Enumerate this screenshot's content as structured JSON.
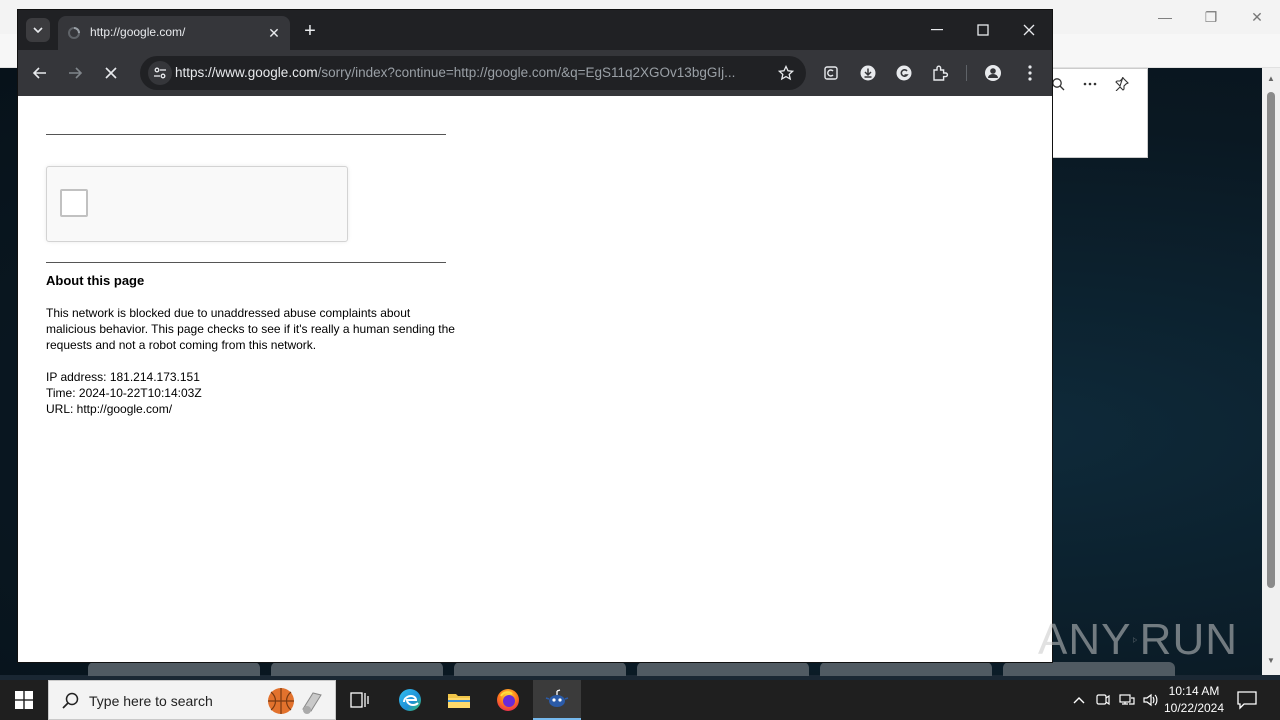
{
  "browser": {
    "tab_title": "http://google.com/",
    "url_host": "https://www.google.com",
    "url_rest": "/sorry/index?continue=http://google.com/&q=EgS11q2XGOv13bgGIj..."
  },
  "page": {
    "about_title": "About this page",
    "about_text": "This network is blocked due to unaddressed abuse complaints about malicious behavior. This page checks to see if it's really a human sending the requests and not a robot coming from this network.",
    "ip_line": "IP address: 181.214.173.151",
    "time_line": "Time: 2024-10-22T10:14:03Z",
    "url_line": "URL: http://google.com/"
  },
  "watermark": {
    "left": "ANY",
    "right": "RUN"
  },
  "taskbar": {
    "search_placeholder": "Type here to search",
    "clock_time": "10:14 AM",
    "clock_date": "10/22/2024"
  },
  "colors": {
    "chrome_dark": "#202124",
    "chrome_toolbar": "#35363a",
    "taskbar": "#1f1f1f",
    "accent": "#76b9ed"
  }
}
